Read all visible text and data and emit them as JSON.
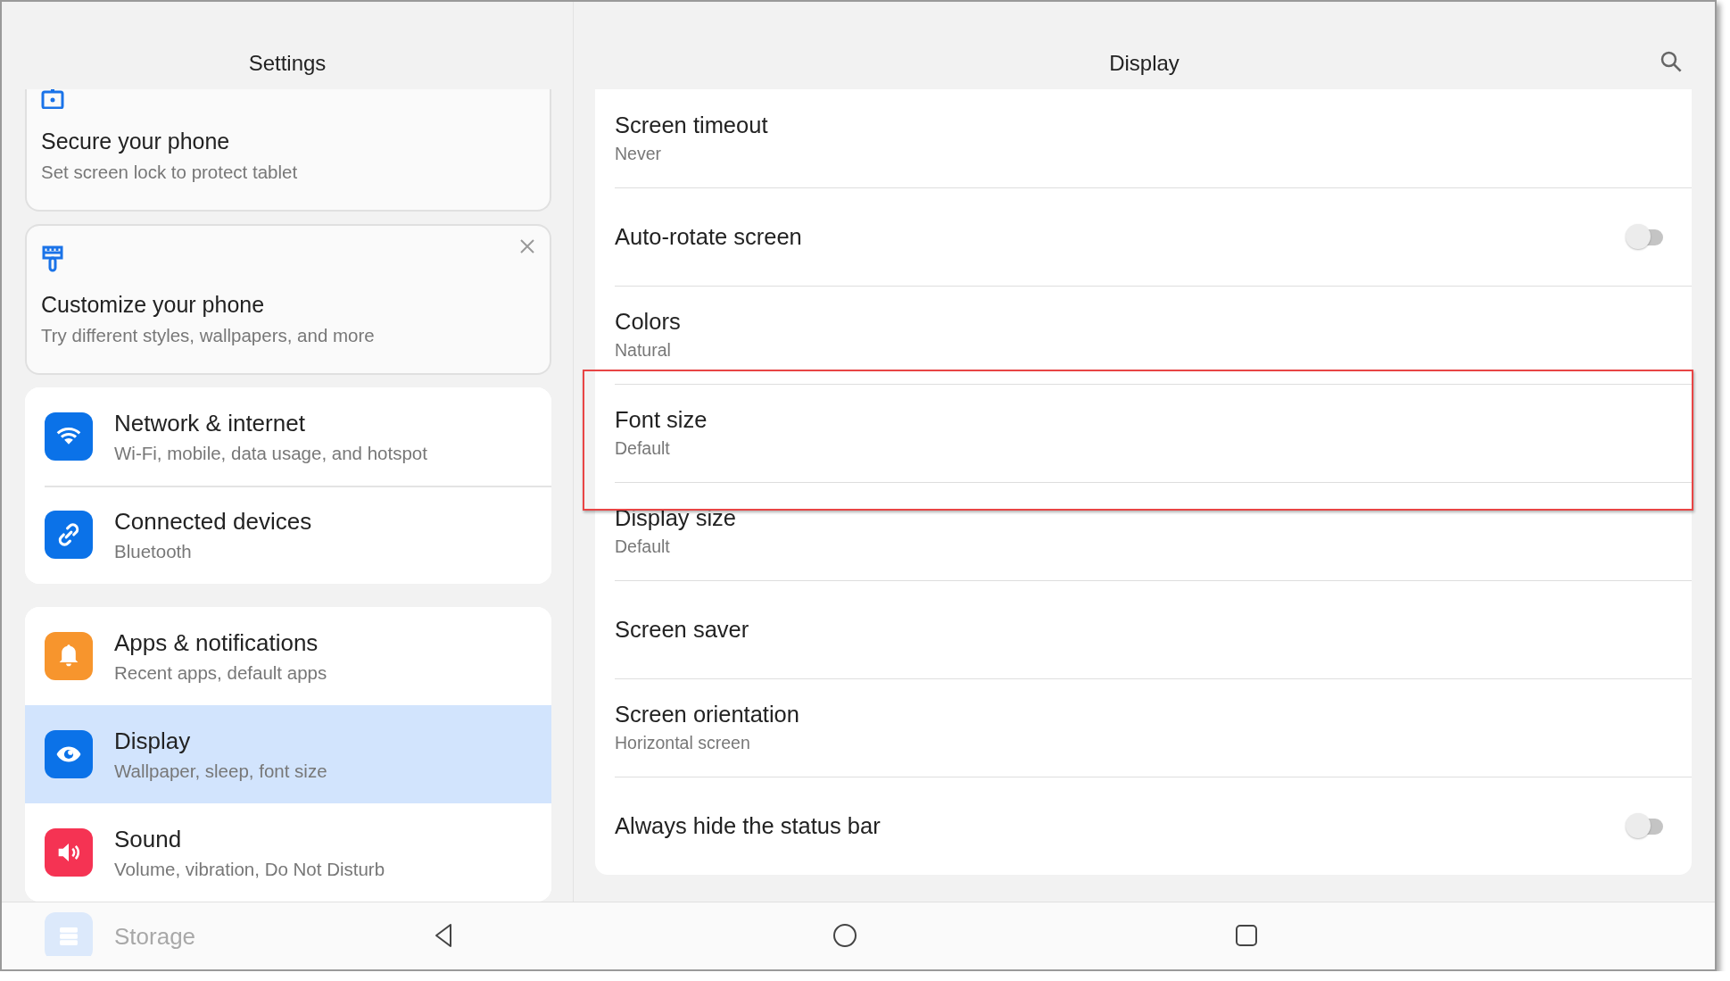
{
  "header": {
    "left_title": "Settings",
    "right_title": "Display"
  },
  "suggestions": [
    {
      "kind": "lock",
      "title": "Secure your phone",
      "subtitle": "Set screen lock to protect tablet",
      "dismissible": false
    },
    {
      "kind": "brush",
      "title": "Customize your phone",
      "subtitle": "Try different styles, wallpapers, and more",
      "dismissible": true
    }
  ],
  "groups": [
    {
      "items": [
        {
          "color": "#0b72e8",
          "title": "Network & internet",
          "subtitle": "Wi-Fi, mobile, data usage, and hotspot",
          "selected": false
        },
        {
          "color": "#0b72e8",
          "title": "Connected devices",
          "subtitle": "Bluetooth",
          "selected": false
        }
      ]
    },
    {
      "items": [
        {
          "color": "#f7952d",
          "title": "Apps & notifications",
          "subtitle": "Recent apps, default apps",
          "selected": false
        },
        {
          "color": "#0b72e8",
          "title": "Display",
          "subtitle": "Wallpaper, sleep, font size",
          "selected": true
        },
        {
          "color": "#f53353",
          "title": "Sound",
          "subtitle": "Volume, vibration, Do Not Disturb",
          "selected": false
        },
        {
          "color": "#dce9fb",
          "title": "Storage",
          "selected": false
        }
      ]
    }
  ],
  "display_rows": [
    {
      "kind": "text",
      "title": "Screen timeout",
      "value": "Never",
      "highlighted": false
    },
    {
      "kind": "toggle",
      "title": "Auto-rotate screen",
      "on": false,
      "highlighted": false
    },
    {
      "kind": "text",
      "title": "Colors",
      "value": "Natural",
      "highlighted": false
    },
    {
      "kind": "text",
      "title": "Font size",
      "value": "Default",
      "highlighted": true
    },
    {
      "kind": "text",
      "title": "Display size",
      "value": "Default",
      "highlighted": false
    },
    {
      "kind": "text",
      "title": "Screen saver",
      "highlighted": false
    },
    {
      "kind": "text",
      "title": "Screen orientation",
      "value": "Horizontal screen",
      "highlighted": false
    },
    {
      "kind": "toggle",
      "title": "Always hide the status bar",
      "on": false,
      "highlighted": false
    }
  ]
}
